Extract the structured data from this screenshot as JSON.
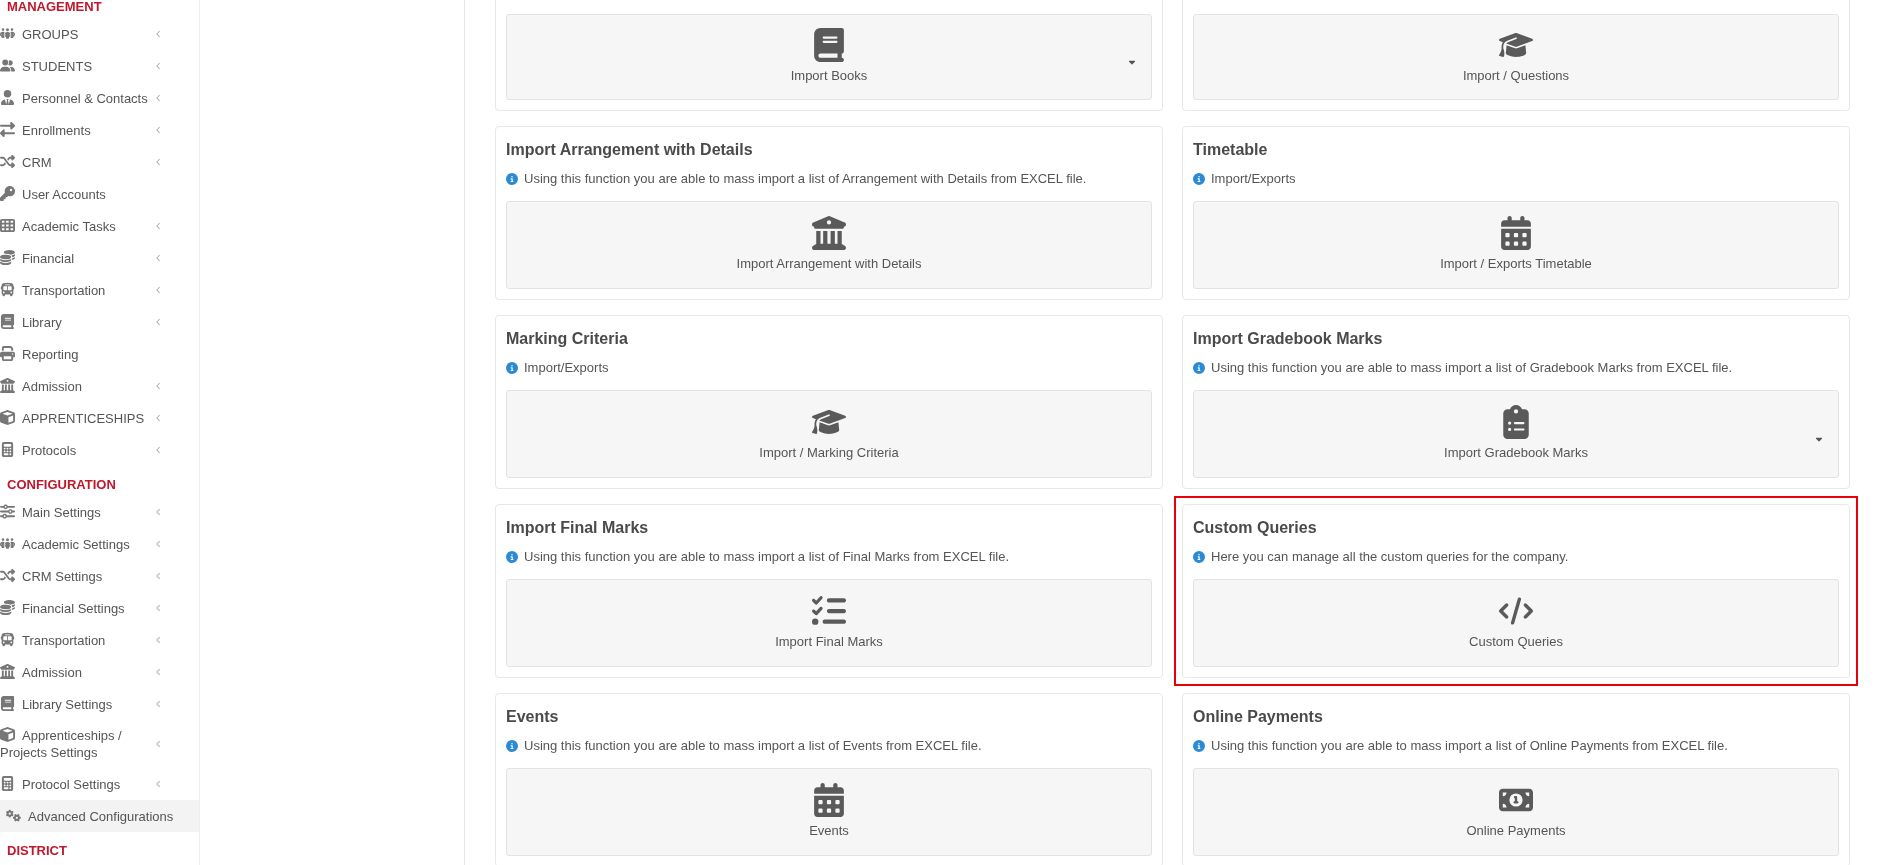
{
  "sidebar": {
    "sections": [
      {
        "title": "MANAGEMENT",
        "items": [
          {
            "label": "GROUPS",
            "has_submenu": true,
            "selected": false
          },
          {
            "label": "STUDENTS",
            "has_submenu": true,
            "selected": false
          },
          {
            "label": "Personnel & Contacts",
            "has_submenu": true,
            "selected": false
          },
          {
            "label": "Enrollments",
            "has_submenu": true,
            "selected": false
          },
          {
            "label": "CRM",
            "has_submenu": true,
            "selected": false
          },
          {
            "label": "User Accounts",
            "has_submenu": false,
            "selected": false
          },
          {
            "label": "Academic Tasks",
            "has_submenu": true,
            "selected": false
          },
          {
            "label": "Financial",
            "has_submenu": true,
            "selected": false
          },
          {
            "label": "Transportation",
            "has_submenu": true,
            "selected": false
          },
          {
            "label": "Library",
            "has_submenu": true,
            "selected": false
          },
          {
            "label": "Reporting",
            "has_submenu": false,
            "selected": false
          },
          {
            "label": "Admission",
            "has_submenu": true,
            "selected": false
          },
          {
            "label": "APPRENTICESHIPS",
            "has_submenu": true,
            "selected": false
          },
          {
            "label": "Protocols",
            "has_submenu": true,
            "selected": false
          }
        ]
      },
      {
        "title": "CONFIGURATION",
        "items": [
          {
            "label": "Main Settings",
            "has_submenu": true,
            "selected": false
          },
          {
            "label": "Academic Settings",
            "has_submenu": true,
            "selected": false
          },
          {
            "label": "CRM Settings",
            "has_submenu": true,
            "selected": false
          },
          {
            "label": "Financial Settings",
            "has_submenu": true,
            "selected": false
          },
          {
            "label": "Transportation",
            "has_submenu": true,
            "selected": false
          },
          {
            "label": "Admission",
            "has_submenu": true,
            "selected": false
          },
          {
            "label": "Library Settings",
            "has_submenu": true,
            "selected": false
          },
          {
            "label": "Apprenticeships / Projects Settings",
            "has_submenu": true,
            "selected": false
          },
          {
            "label": "Protocol Settings",
            "has_submenu": true,
            "selected": false
          },
          {
            "label": "Advanced Configurations",
            "has_submenu": false,
            "selected": true
          }
        ]
      },
      {
        "title": "DISTRICT"
      }
    ]
  },
  "cards": [
    {
      "button": {
        "label": "Import Books",
        "has_dropdown": true
      },
      "highlighted": false
    },
    {
      "button": {
        "label": "Import / Questions",
        "has_dropdown": false
      },
      "highlighted": false
    },
    {
      "title": "Import Arrangement with Details",
      "description": "Using this function you are able to mass import a list of Arrangement with Details from EXCEL file.",
      "button": {
        "label": "Import Arrangement with Details",
        "has_dropdown": false
      },
      "highlighted": false
    },
    {
      "title": "Timetable",
      "description": "Import/Exports",
      "button": {
        "label": "Import / Exports Timetable",
        "has_dropdown": false
      },
      "highlighted": false
    },
    {
      "title": "Marking Criteria",
      "description": "Import/Exports",
      "button": {
        "label": "Import / Marking Criteria",
        "has_dropdown": false
      },
      "highlighted": false
    },
    {
      "title": "Import Gradebook Marks",
      "description": "Using this function you are able to mass import a list of Gradebook Marks from EXCEL file.",
      "button": {
        "label": "Import Gradebook Marks",
        "has_dropdown": true
      },
      "highlighted": false
    },
    {
      "title": "Import Final Marks",
      "description": "Using this function you are able to mass import a list of Final Marks from EXCEL file.",
      "button": {
        "label": "Import Final Marks",
        "has_dropdown": false
      },
      "highlighted": false
    },
    {
      "title": "Custom Queries",
      "description": "Here you can manage all the custom queries for the company.",
      "button": {
        "label": "Custom Queries",
        "has_dropdown": false
      },
      "highlighted": true
    },
    {
      "title": "Events",
      "description": "Using this function you are able to mass import a list of Events from EXCEL file.",
      "button": {
        "label": "Events",
        "has_dropdown": false
      },
      "highlighted": false
    },
    {
      "title": "Online Payments",
      "description": "Using this function you are able to mass import a list of Online Payments from EXCEL file.",
      "button": {
        "label": "Online Payments",
        "has_dropdown": false
      },
      "highlighted": false
    }
  ]
}
